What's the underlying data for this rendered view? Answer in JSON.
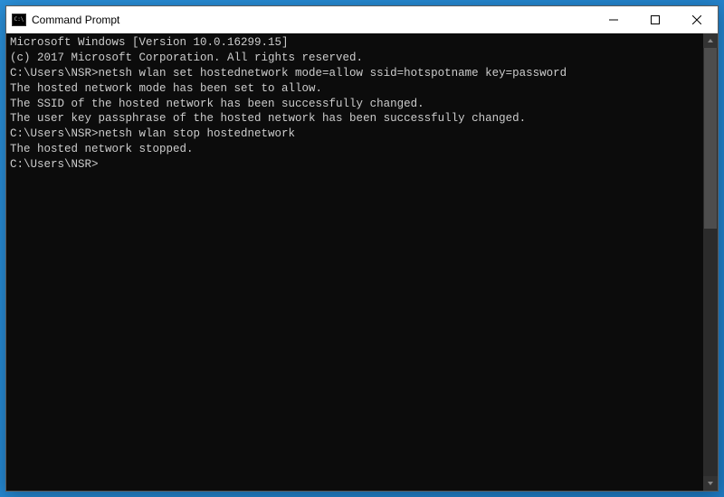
{
  "window": {
    "title": "Command Prompt"
  },
  "terminal": {
    "lines": [
      "Microsoft Windows [Version 10.0.16299.15]",
      "(c) 2017 Microsoft Corporation. All rights reserved.",
      "",
      "C:\\Users\\NSR>netsh wlan set hostednetwork mode=allow ssid=hotspotname key=password",
      "The hosted network mode has been set to allow.",
      "The SSID of the hosted network has been successfully changed.",
      "The user key passphrase of the hosted network has been successfully changed.",
      "",
      "",
      "C:\\Users\\NSR>netsh wlan stop hostednetwork",
      "The hosted network stopped.",
      "",
      "",
      "C:\\Users\\NSR>"
    ]
  }
}
